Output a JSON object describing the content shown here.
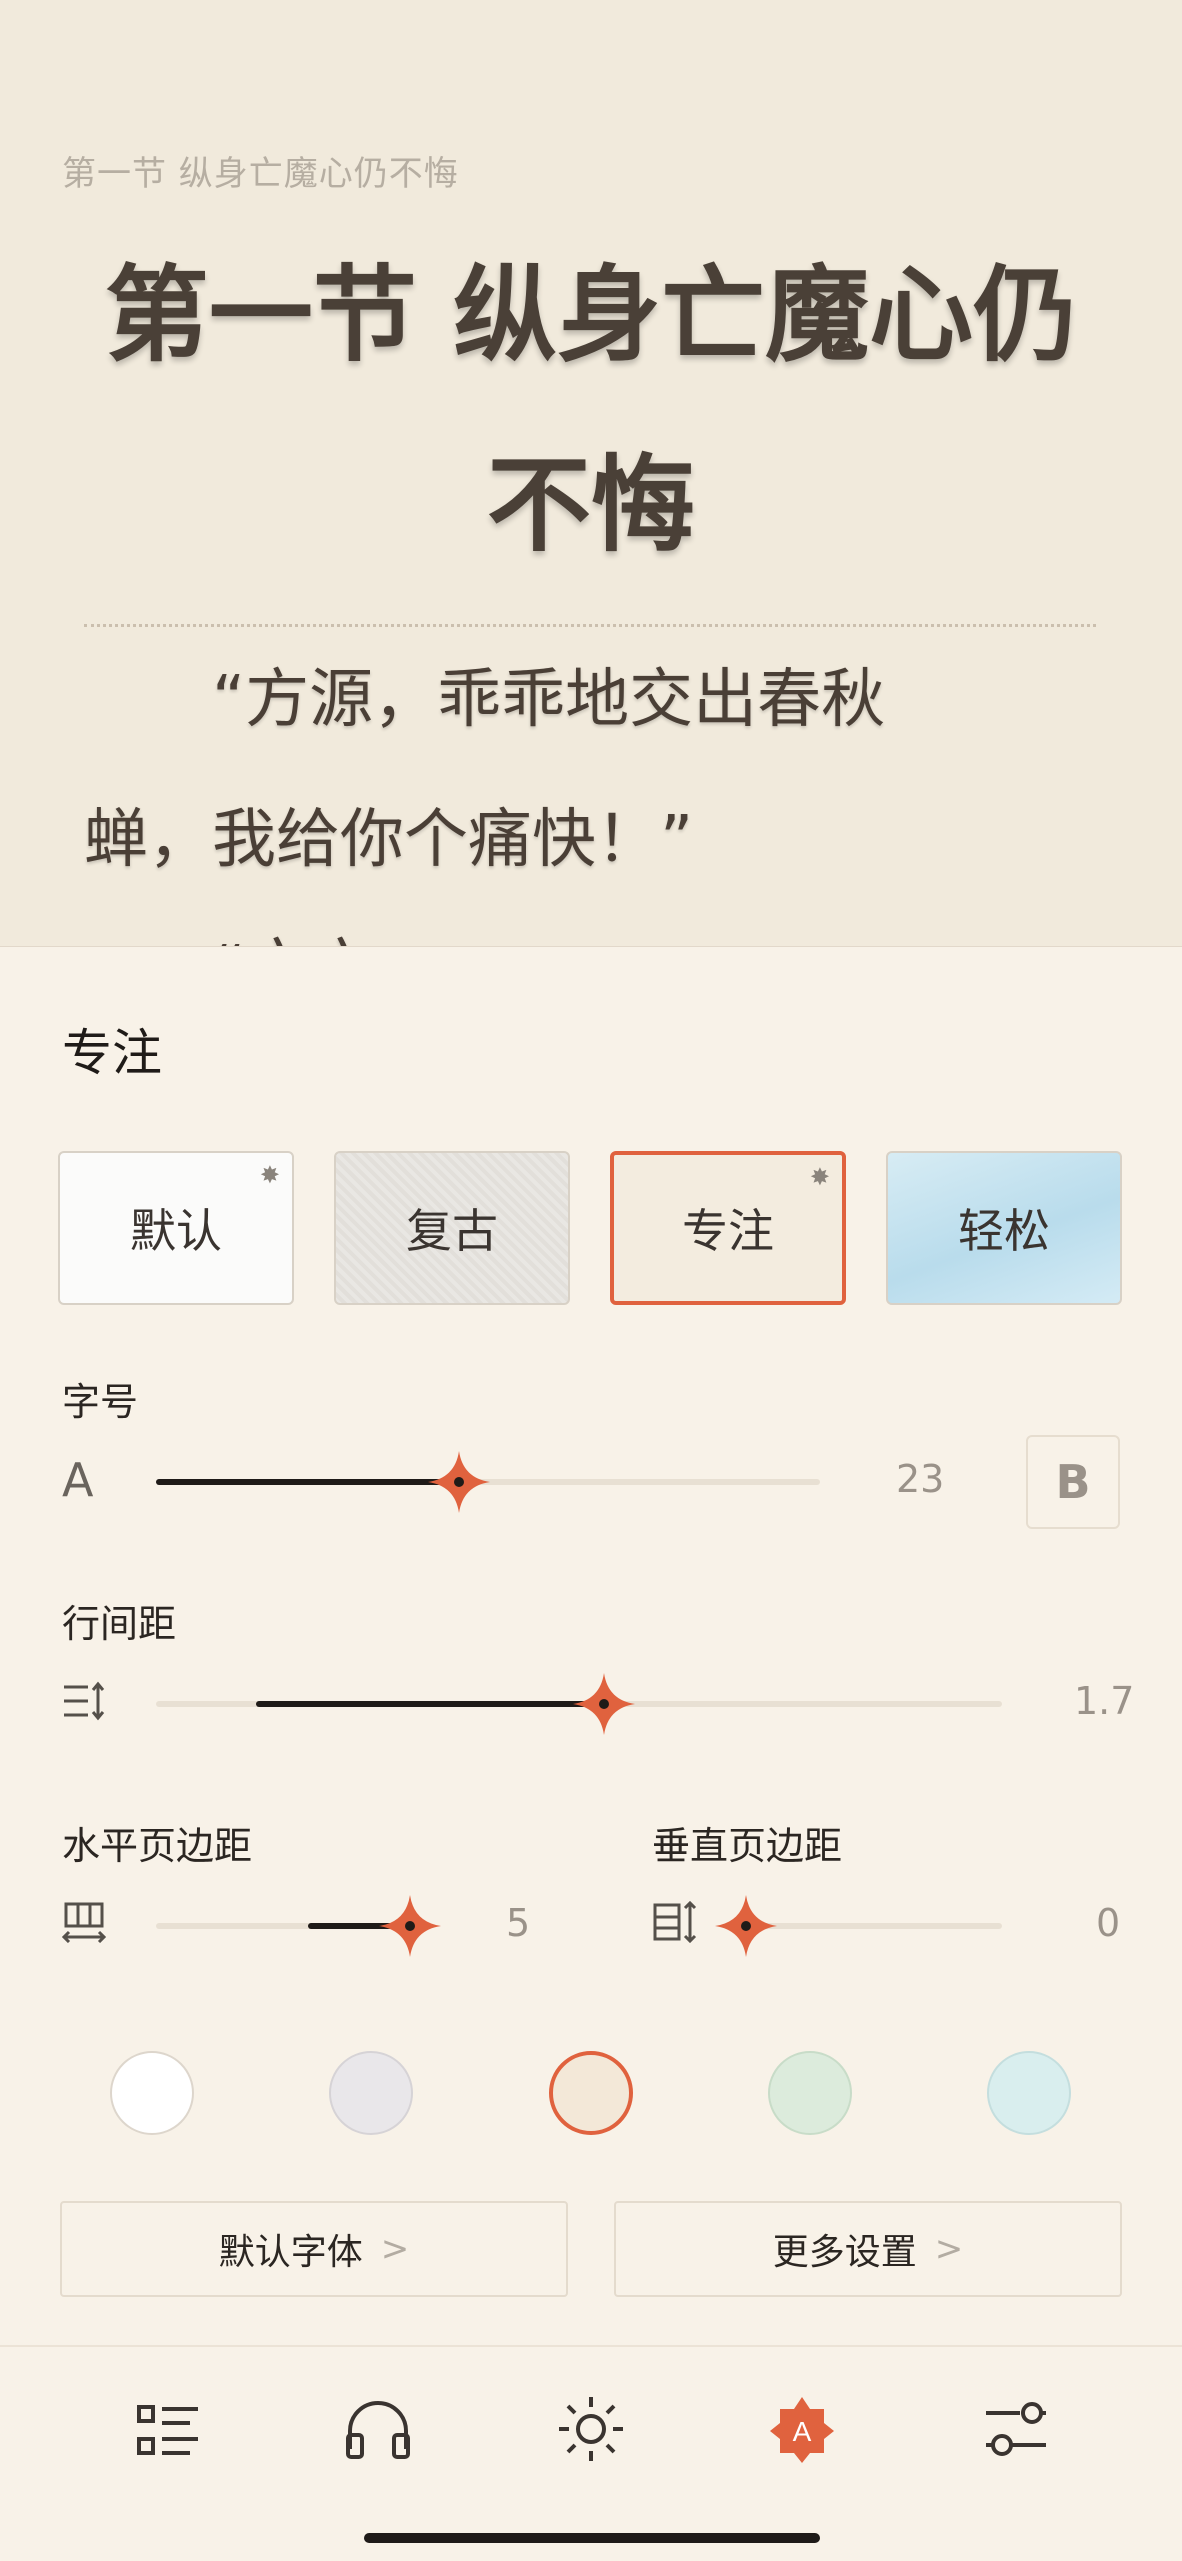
{
  "reader": {
    "chapter_header": "第一节 纵身亡魔心仍不悔",
    "chapter_title_line1": "第一节 纵身亡魔心仍",
    "chapter_title_line2": "不悔",
    "para1_line1": "“方源，乖乖地交出春秋",
    "para1_line2": "蝉，我给你个痛快！”",
    "para2_partial": "“方方..."
  },
  "panel": {
    "title": "专注",
    "themes": [
      {
        "label": "默认",
        "starred": true,
        "selected": false
      },
      {
        "label": "复古",
        "starred": false,
        "selected": false
      },
      {
        "label": "专注",
        "starred": true,
        "selected": true
      },
      {
        "label": "轻松",
        "starred": false,
        "selected": false
      }
    ],
    "font_size": {
      "label": "字号",
      "small_icon": "A",
      "value": "23",
      "big_icon": "B",
      "level": 0.39
    },
    "line_spacing": {
      "label": "行间距",
      "value": "1.7",
      "level": 0.53
    },
    "h_margin": {
      "label": "水平页边距",
      "value": "5",
      "level": 0.88
    },
    "v_margin": {
      "label": "垂直页边距",
      "value": "0",
      "level": 0.0
    },
    "bg_colors": [
      "#ffffff",
      "#e9e7ea",
      "#f3e8d8",
      "#dcebdc",
      "#d9eeee"
    ],
    "selected_bg_index": 2,
    "buttons": {
      "default_font": "默认字体",
      "more_settings": "更多设置",
      "chevron": ">"
    },
    "nav": [
      "toc-icon",
      "headphones-icon",
      "brightness-icon",
      "font-settings-icon",
      "sliders-icon"
    ]
  },
  "colors": {
    "accent": "#e0623e",
    "panel_bg": "#f8f2e8",
    "reader_bg": "#f1eadc"
  }
}
